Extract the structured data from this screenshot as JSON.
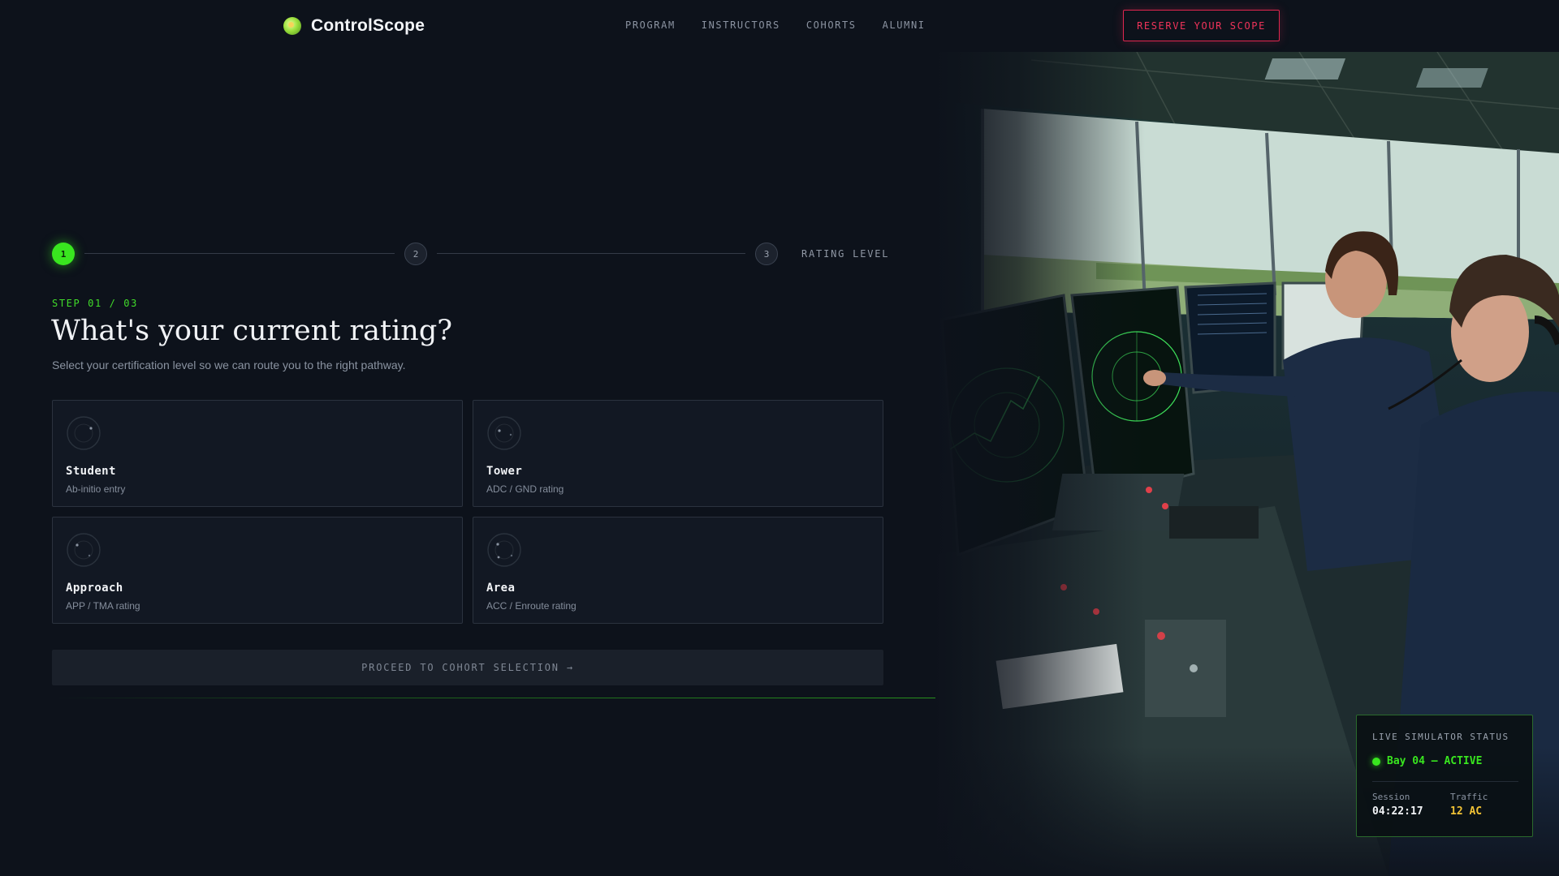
{
  "brand": {
    "name": "ControlScope",
    "logo_icon": "radar-globe-icon"
  },
  "nav": {
    "links": [
      "PROGRAM",
      "INSTRUCTORS",
      "COHORTS",
      "ALUMNI"
    ],
    "cta_label": "RESERVE YOUR SCOPE"
  },
  "stepper": {
    "steps": [
      "1",
      "2",
      "3"
    ],
    "current_step": 1,
    "final_label": "RATING LEVEL"
  },
  "form": {
    "kicker": "STEP 01 / 03",
    "title": "What's your current rating?",
    "subtitle": "Select your certification level so we can route you to the right pathway.",
    "options": [
      {
        "title": "Student",
        "desc": "Ab-initio entry",
        "icon": "radar-scope-icon"
      },
      {
        "title": "Tower",
        "desc": "ADC / GND rating",
        "icon": "radar-scope-icon"
      },
      {
        "title": "Approach",
        "desc": "APP / TMA rating",
        "icon": "radar-scope-icon"
      },
      {
        "title": "Area",
        "desc": "ACC / Enroute rating",
        "icon": "radar-scope-icon"
      }
    ],
    "proceed_label": "PROCEED TO COHORT SELECTION →"
  },
  "status": {
    "heading": "LIVE SIMULATOR STATUS",
    "state": "Bay 04 — ACTIVE",
    "session_label": "Session",
    "session_value": "04:22:17",
    "traffic_label": "Traffic",
    "traffic_value": "12 AC"
  },
  "colors": {
    "background": "#0d121b",
    "accent_green": "#39e61f",
    "cta_red": "#e0264f",
    "traffic_amber": "#f2c335"
  }
}
